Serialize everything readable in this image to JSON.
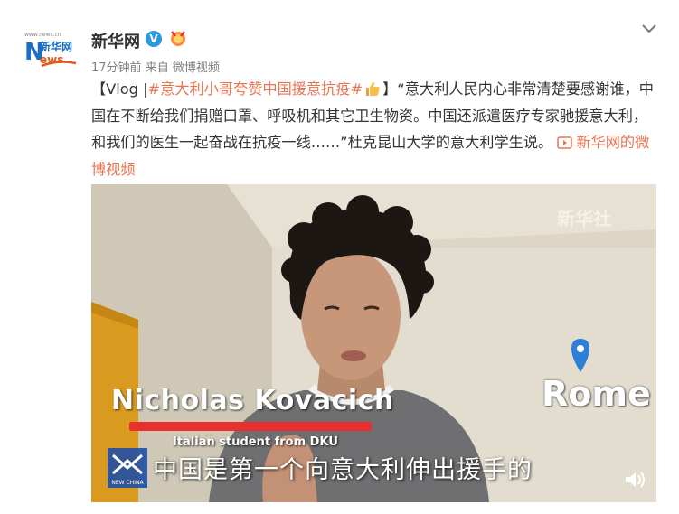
{
  "header": {
    "username": "新华网",
    "verified_badge": "V",
    "time": "17分钟前",
    "source_prefix": "来自",
    "source": "微博视频",
    "avatar_text_cn": "新华网",
    "avatar_text_en": "News"
  },
  "post": {
    "prefix": "【Vlog |",
    "hashtag": "#意大利小哥夸赞中国援意抗疫#",
    "body": "】“意大利人民内心非常清楚要感谢谁，中国在不断给我们捐赠口罩、呼吸机和其它卫生物资。中国还派遣医疗专家驰援意大利，和我们的医生一起奋战在抗疫一线……”杜克昆山大学的意大利学生说。",
    "video_link": "新华网的微博视频"
  },
  "video": {
    "name": "Nicholas Kovacich",
    "role": "Italian student from DKU",
    "subtitle": "中国是第一个向意大利伸出援手的",
    "city": "Rome",
    "watermark": "新华社",
    "logo_label": "NEW CHINA"
  },
  "colors": {
    "accent": "#eb7350",
    "verified": "#2a9ae0",
    "red_bar": "#e8302f",
    "pin": "#2f7fd6"
  },
  "icons": [
    "chevron-down-icon",
    "verified-icon",
    "medal-icon",
    "thumbs-up-icon",
    "video-link-icon",
    "location-pin-icon",
    "sound-icon"
  ]
}
